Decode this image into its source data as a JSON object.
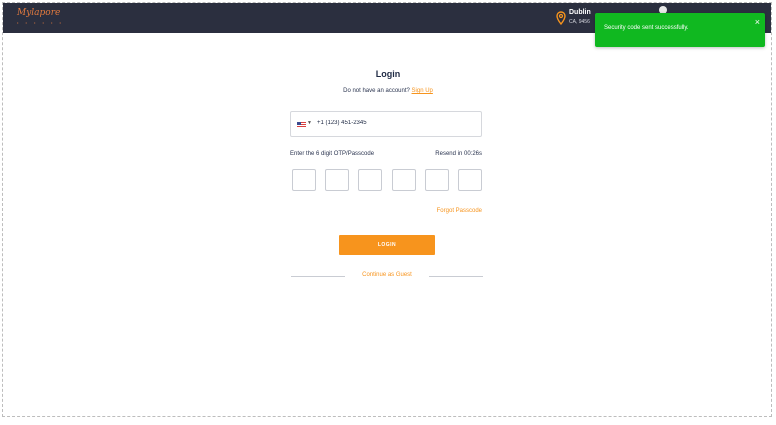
{
  "header": {
    "logo_text": "Mylapore",
    "logo_subtext": "• • • • • •",
    "location_city": "Dublin",
    "location_zip": "CA, 9456"
  },
  "toast": {
    "message": "Security code sent successfully.",
    "close_label": "×",
    "color": "#10b820"
  },
  "login": {
    "title": "Login",
    "signup_prompt": "Do not have an account?",
    "signup_link": "Sign Up",
    "phone": {
      "country_icon": "us-flag-icon",
      "value": "+1 (123) 451-2345"
    },
    "otp_label": "Enter the 6 digit OTP/Passcode",
    "resend_text": "Resend in 00:26s",
    "otp_boxes": [
      "",
      "",
      "",
      "",
      "",
      ""
    ],
    "forgot_label": "Forgot Passcode",
    "login_button": "LOGIN",
    "guest_label": "Continue as Guest"
  },
  "colors": {
    "accent": "#f7941d",
    "header_bg": "#2b2f3f",
    "toast_bg": "#10b820"
  }
}
